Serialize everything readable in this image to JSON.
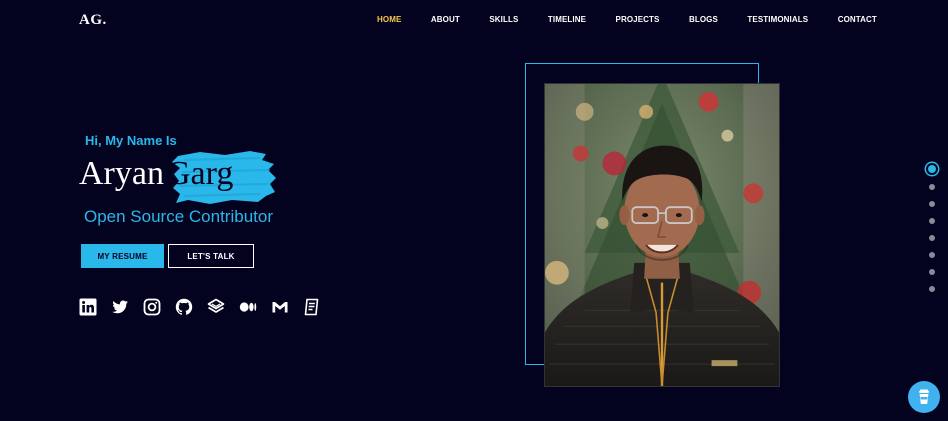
{
  "header": {
    "logo": "AG.",
    "nav": [
      {
        "label": "HOME",
        "active": true
      },
      {
        "label": "ABOUT"
      },
      {
        "label": "SKILLS"
      },
      {
        "label": "TIMELINE"
      },
      {
        "label": "PROJECTS"
      },
      {
        "label": "BLOGS"
      },
      {
        "label": "TESTIMONIALS"
      },
      {
        "label": "CONTACT"
      }
    ]
  },
  "hero": {
    "greeting": "Hi, My Name Is",
    "first_name": "Aryan",
    "last_name": "Garg",
    "role": "Open Source Contributor",
    "buttons": {
      "resume": "MY RESUME",
      "talk": "LET'S TALK"
    },
    "socials": [
      "linkedin-icon",
      "twitter-icon",
      "instagram-icon",
      "github-icon",
      "layers-icon",
      "medium-icon",
      "gmail-icon",
      "resume-doc-icon"
    ]
  },
  "section_dots": {
    "count": 8,
    "active_index": 0
  },
  "floating": {
    "icon": "coffee-cup-icon"
  },
  "colors": {
    "background": "#03031f",
    "accent": "#2ab7ea",
    "nav_active": "#f7c948",
    "text": "#ffffff"
  }
}
